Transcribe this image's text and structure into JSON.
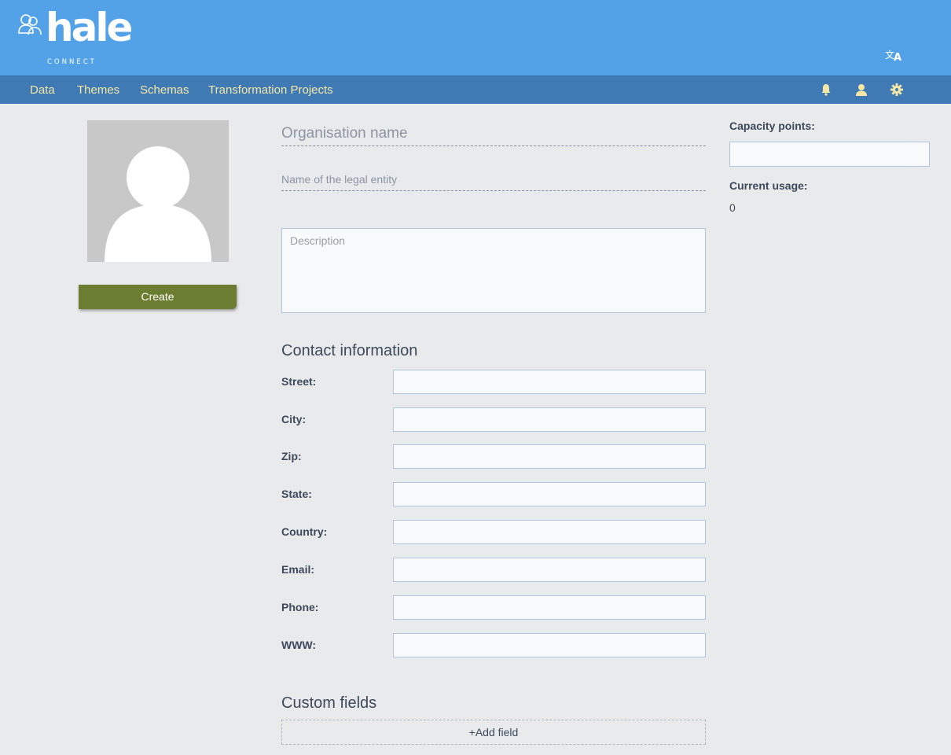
{
  "header": {
    "logo_text": "hale",
    "logo_sub": "CONNECT",
    "language_icon": "translate-icon"
  },
  "nav": {
    "items": [
      {
        "label": "Data"
      },
      {
        "label": "Themes"
      },
      {
        "label": "Schemas"
      },
      {
        "label": "Transformation Projects"
      }
    ],
    "icons": [
      "bell-icon",
      "user-icon",
      "gear-icon"
    ]
  },
  "profile": {
    "avatar_icon": "user-avatar-placeholder-icon",
    "create_label": "Create"
  },
  "form": {
    "org_name_placeholder": "Organisation name",
    "legal_name_placeholder": "Name of the legal entity",
    "description_placeholder": "Description",
    "contact_title": "Contact information",
    "fields": [
      {
        "label": "Street:",
        "value": ""
      },
      {
        "label": "City:",
        "value": ""
      },
      {
        "label": "Zip:",
        "value": ""
      },
      {
        "label": "State:",
        "value": ""
      },
      {
        "label": "Country:",
        "value": ""
      },
      {
        "label": "Email:",
        "value": ""
      },
      {
        "label": "Phone:",
        "value": ""
      },
      {
        "label": "WWW:",
        "value": ""
      }
    ],
    "custom_title": "Custom fields",
    "add_field_label": "+Add field"
  },
  "capacity": {
    "label": "Capacity points:",
    "value": "",
    "usage_label": "Current usage:",
    "usage_value": "0"
  },
  "colors": {
    "header_bg": "#53a2e8",
    "nav_bg": "#3f7ab4",
    "nav_text": "#f5e7a6",
    "create_button": "#6b7d30",
    "page_bg": "#e9eaec"
  }
}
